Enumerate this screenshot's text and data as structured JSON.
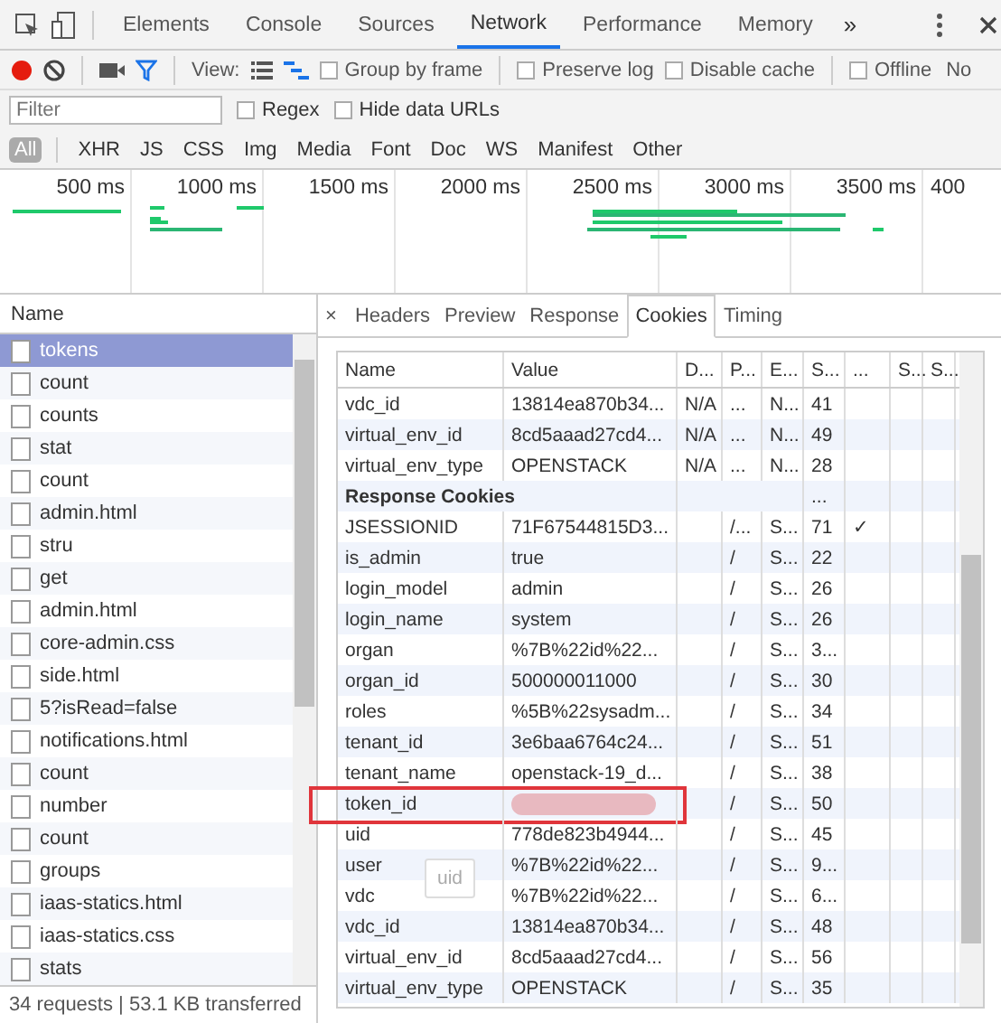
{
  "devtools_tabs": [
    {
      "label": "Elements",
      "selected": false
    },
    {
      "label": "Console",
      "selected": false
    },
    {
      "label": "Sources",
      "selected": false
    },
    {
      "label": "Network",
      "selected": true
    },
    {
      "label": "Performance",
      "selected": false
    },
    {
      "label": "Memory",
      "selected": false
    }
  ],
  "more_tabs": "»",
  "toolbar": {
    "view_label": "View:",
    "large_rows": false,
    "waterfall": true,
    "checkboxes": [
      {
        "label": "Group by frame",
        "checked": false
      },
      {
        "label": "Preserve log",
        "checked": false
      },
      {
        "label": "Disable cache",
        "checked": false
      },
      {
        "label": "Offline",
        "checked": false
      }
    ],
    "throttling": "No"
  },
  "filter": {
    "placeholder": "Filter",
    "checkboxes": [
      {
        "label": "Regex",
        "checked": false
      },
      {
        "label": "Hide data URLs",
        "checked": false
      }
    ]
  },
  "types": [
    {
      "label": "All",
      "selected": true
    },
    {
      "label": "XHR",
      "selected": false
    },
    {
      "label": "JS",
      "selected": false
    },
    {
      "label": "CSS",
      "selected": false
    },
    {
      "label": "Img",
      "selected": false
    },
    {
      "label": "Media",
      "selected": false
    },
    {
      "label": "Font",
      "selected": false
    },
    {
      "label": "Doc",
      "selected": false
    },
    {
      "label": "WS",
      "selected": false
    },
    {
      "label": "Manifest",
      "selected": false
    },
    {
      "label": "Other",
      "selected": false
    }
  ],
  "timeline": {
    "ticks": [
      "500 ms",
      "1000 ms",
      "1500 ms",
      "2000 ms",
      "2500 ms",
      "3000 ms",
      "3500 ms",
      "400"
    ]
  },
  "requests": {
    "header": "Name",
    "items": [
      {
        "name": "tokens",
        "selected": true
      },
      {
        "name": "count",
        "selected": false
      },
      {
        "name": "counts",
        "selected": false
      },
      {
        "name": "stat",
        "selected": false
      },
      {
        "name": "count",
        "selected": false
      },
      {
        "name": "admin.html",
        "selected": false
      },
      {
        "name": "stru",
        "selected": false
      },
      {
        "name": "get",
        "selected": false
      },
      {
        "name": "admin.html",
        "selected": false
      },
      {
        "name": "core-admin.css",
        "selected": false
      },
      {
        "name": "side.html",
        "selected": false
      },
      {
        "name": "5?isRead=false",
        "selected": false
      },
      {
        "name": "notifications.html",
        "selected": false
      },
      {
        "name": "count",
        "selected": false
      },
      {
        "name": "number",
        "selected": false
      },
      {
        "name": "count",
        "selected": false
      },
      {
        "name": "groups",
        "selected": false
      },
      {
        "name": "iaas-statics.html",
        "selected": false
      },
      {
        "name": "iaas-statics.css",
        "selected": false
      },
      {
        "name": "stats",
        "selected": false
      }
    ],
    "status": "34 requests | 53.1 KB transferred"
  },
  "detail_close": "×",
  "detail_tabs": [
    {
      "label": "Headers",
      "selected": false
    },
    {
      "label": "Preview",
      "selected": false
    },
    {
      "label": "Response",
      "selected": false
    },
    {
      "label": "Cookies",
      "selected": true
    },
    {
      "label": "Timing",
      "selected": false
    }
  ],
  "cookies": {
    "columns": [
      "Name",
      "Value",
      "D...",
      "P...",
      "E...",
      "S...",
      "...",
      "S...",
      "S..."
    ],
    "rows": [
      {
        "kind": "cookie",
        "cells": [
          "vdc_id",
          "13814ea870b34...",
          "N/A",
          "...",
          "N...",
          "41",
          ""
        ]
      },
      {
        "kind": "cookie",
        "cells": [
          "virtual_env_id",
          "8cd5aaad27cd4...",
          "N/A",
          "...",
          "N...",
          "49",
          ""
        ]
      },
      {
        "kind": "cookie",
        "cells": [
          "virtual_env_type",
          "OPENSTACK",
          "N/A",
          "...",
          "N...",
          "28",
          ""
        ]
      },
      {
        "kind": "section",
        "label": "Response Cookies",
        "size": "..."
      },
      {
        "kind": "cookie",
        "cells": [
          "JSESSIONID",
          "71F67544815D3...",
          "",
          "/...",
          "S...",
          "71",
          "✓"
        ]
      },
      {
        "kind": "cookie",
        "cells": [
          "is_admin",
          "true",
          "",
          "/",
          "S...",
          "22",
          ""
        ]
      },
      {
        "kind": "cookie",
        "cells": [
          "login_model",
          "admin",
          "",
          "/",
          "S...",
          "26",
          ""
        ]
      },
      {
        "kind": "cookie",
        "cells": [
          "login_name",
          "system",
          "",
          "/",
          "S...",
          "26",
          ""
        ]
      },
      {
        "kind": "cookie",
        "cells": [
          "organ",
          "%7B%22id%22...",
          "",
          "/",
          "S...",
          "3...",
          ""
        ]
      },
      {
        "kind": "cookie",
        "cells": [
          "organ_id",
          "500000011000",
          "",
          "/",
          "S...",
          "30",
          ""
        ]
      },
      {
        "kind": "cookie",
        "cells": [
          "roles",
          "%5B%22sysadm...",
          "",
          "/",
          "S...",
          "34",
          ""
        ]
      },
      {
        "kind": "cookie",
        "cells": [
          "tenant_id",
          "3e6baa6764c24...",
          "",
          "/",
          "S...",
          "51",
          ""
        ]
      },
      {
        "kind": "cookie",
        "cells": [
          "tenant_name",
          "openstack-19_d...",
          "",
          "/",
          "S...",
          "38",
          ""
        ]
      },
      {
        "kind": "redacted",
        "highlighted": true,
        "cells": [
          "token_id",
          "",
          "",
          "/",
          "S...",
          "50",
          ""
        ]
      },
      {
        "kind": "cookie",
        "cells": [
          "uid",
          "778de823b4944...",
          "",
          "/",
          "S...",
          "45",
          ""
        ]
      },
      {
        "kind": "cookie",
        "cells": [
          "user",
          "%7B%22id%22...",
          "",
          "/",
          "S...",
          "9...",
          ""
        ]
      },
      {
        "kind": "cookie",
        "cells": [
          "vdc",
          "%7B%22id%22...",
          "",
          "/",
          "S...",
          "6...",
          ""
        ]
      },
      {
        "kind": "cookie",
        "cells": [
          "vdc_id",
          "13814ea870b34...",
          "",
          "/",
          "S...",
          "48",
          ""
        ]
      },
      {
        "kind": "cookie",
        "cells": [
          "virtual_env_id",
          "8cd5aaad27cd4...",
          "",
          "/",
          "S...",
          "56",
          ""
        ]
      },
      {
        "kind": "cookie",
        "cells": [
          "virtual_env_type",
          "OPENSTACK",
          "",
          "/",
          "S...",
          "35",
          ""
        ]
      }
    ]
  },
  "tooltip": "uid"
}
